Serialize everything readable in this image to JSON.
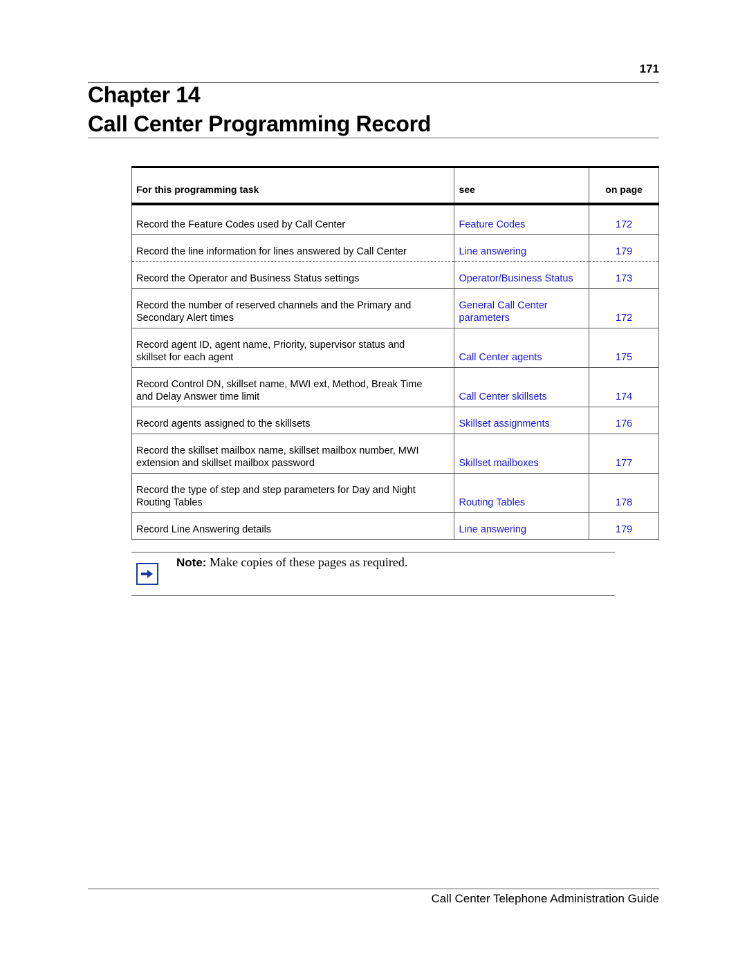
{
  "header": {
    "page_number": "171",
    "chapter_label": "Chapter 14",
    "chapter_title": "Call Center Programming Record"
  },
  "table": {
    "columns": [
      "For this programming task",
      "see",
      "on page"
    ],
    "rows": [
      {
        "task": [
          "Record the Feature Codes used by Call Center"
        ],
        "see": [
          "Feature Codes"
        ],
        "page": "172"
      },
      {
        "task": [
          "Record the line information for lines answered by Call Center"
        ],
        "see": [
          "Line answering"
        ],
        "page": "179"
      },
      {
        "task": [
          "Record the Operator and Business Status settings"
        ],
        "see": [
          "Operator/Business Status"
        ],
        "page": "173"
      },
      {
        "task": [
          "Record the number of reserved channels and the Primary and",
          "Secondary Alert times"
        ],
        "see": [
          "General Call Center",
          "parameters"
        ],
        "page": "172"
      },
      {
        "task": [
          "Record agent ID, agent name, Priority, supervisor status and",
          "skillset for each agent"
        ],
        "see": [
          "Call Center agents"
        ],
        "page": "175"
      },
      {
        "task": [
          "Record Control DN, skillset name, MWI ext, Method, Break Time",
          "and Delay Answer time limit"
        ],
        "see": [
          "Call Center skillsets"
        ],
        "page": "174"
      },
      {
        "task": [
          "Record agents assigned to the skillsets"
        ],
        "see": [
          "Skillset assignments"
        ],
        "page": "176"
      },
      {
        "task": [
          "Record the skillset mailbox name, skillset mailbox number, MWI",
          "extension and skillset mailbox password"
        ],
        "see": [
          "Skillset mailboxes"
        ],
        "page": "177"
      },
      {
        "task": [
          "Record the type of step and step parameters for Day and Night",
          "Routing Tables"
        ],
        "see": [
          "Routing Tables"
        ],
        "page": "178"
      },
      {
        "task": [
          "Record Line Answering details"
        ],
        "see": [
          "Line answering"
        ],
        "page": "179"
      }
    ]
  },
  "note": {
    "icon": "arrow-right-icon",
    "label": "Note:",
    "text": " Make copies of these pages as required."
  },
  "footer": {
    "title": "Call Center Telephone Administration Guide"
  },
  "colors": {
    "link": "#1515e6",
    "icon": "#1a3aa0"
  }
}
